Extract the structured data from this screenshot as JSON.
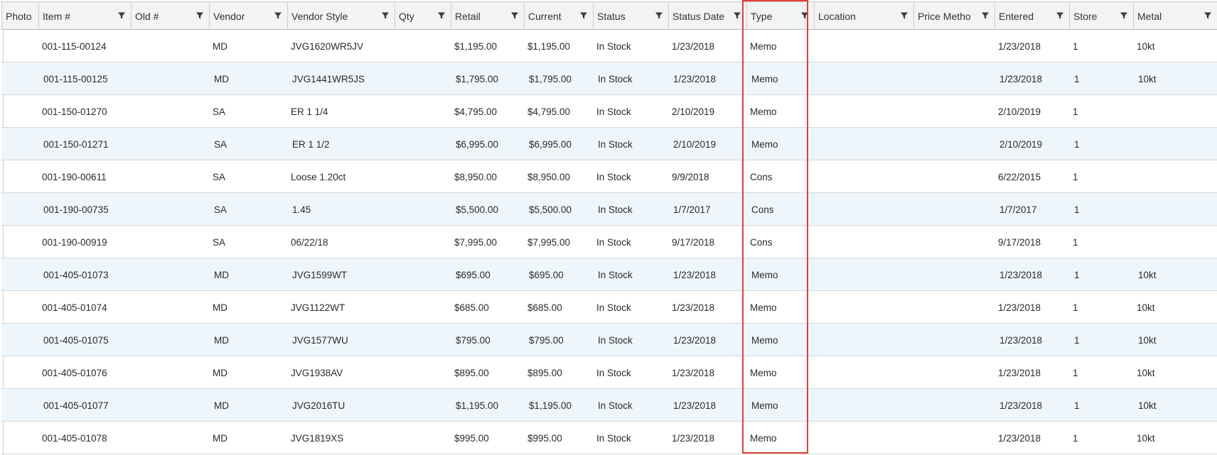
{
  "columns": [
    {
      "key": "photo",
      "label": "Photo",
      "filter": false
    },
    {
      "key": "item",
      "label": "Item #",
      "filter": true
    },
    {
      "key": "old",
      "label": "Old #",
      "filter": true
    },
    {
      "key": "vendor",
      "label": "Vendor",
      "filter": true
    },
    {
      "key": "vendor_style",
      "label": "Vendor Style",
      "filter": true
    },
    {
      "key": "qty",
      "label": "Qty",
      "filter": true
    },
    {
      "key": "retail",
      "label": "Retail",
      "filter": true
    },
    {
      "key": "current",
      "label": "Current",
      "filter": true
    },
    {
      "key": "status",
      "label": "Status",
      "filter": true
    },
    {
      "key": "status_date",
      "label": "Status Date",
      "filter": true
    },
    {
      "key": "type",
      "label": "Type",
      "filter": true
    },
    {
      "key": "location",
      "label": "Location",
      "filter": true
    },
    {
      "key": "price_method",
      "label": "Price Metho",
      "filter": true
    },
    {
      "key": "entered",
      "label": "Entered",
      "filter": true
    },
    {
      "key": "store",
      "label": "Store",
      "filter": true
    },
    {
      "key": "metal",
      "label": "Metal",
      "filter": true
    }
  ],
  "rows": [
    {
      "item": "001-115-00124",
      "old": "",
      "vendor": "MD",
      "vendor_style": "JVG1620WR5JV",
      "qty": "",
      "retail": "$1,195.00",
      "current": "$1,195.00",
      "status": "In Stock",
      "status_date": "1/23/2018",
      "type": "Memo",
      "location": "",
      "price_method": "",
      "entered": "1/23/2018",
      "store": "1",
      "metal": "10kt"
    },
    {
      "item": "001-115-00125",
      "old": "",
      "vendor": "MD",
      "vendor_style": "JVG1441WR5JS",
      "qty": "",
      "retail": "$1,795.00",
      "current": "$1,795.00",
      "status": "In Stock",
      "status_date": "1/23/2018",
      "type": "Memo",
      "location": "",
      "price_method": "",
      "entered": "1/23/2018",
      "store": "1",
      "metal": "10kt"
    },
    {
      "item": "001-150-01270",
      "old": "",
      "vendor": "SA",
      "vendor_style": "ER 1 1/4",
      "qty": "",
      "retail": "$4,795.00",
      "current": "$4,795.00",
      "status": "In Stock",
      "status_date": "2/10/2019",
      "type": "Memo",
      "location": "",
      "price_method": "",
      "entered": "2/10/2019",
      "store": "1",
      "metal": ""
    },
    {
      "item": "001-150-01271",
      "old": "",
      "vendor": "SA",
      "vendor_style": "ER 1 1/2",
      "qty": "",
      "retail": "$6,995.00",
      "current": "$6,995.00",
      "status": "In Stock",
      "status_date": "2/10/2019",
      "type": "Memo",
      "location": "",
      "price_method": "",
      "entered": "2/10/2019",
      "store": "1",
      "metal": ""
    },
    {
      "item": "001-190-00611",
      "old": "",
      "vendor": "SA",
      "vendor_style": "Loose 1.20ct",
      "qty": "",
      "retail": "$8,950.00",
      "current": "$8,950.00",
      "status": "In Stock",
      "status_date": "9/9/2018",
      "type": "Cons",
      "location": "",
      "price_method": "",
      "entered": "6/22/2015",
      "store": "1",
      "metal": ""
    },
    {
      "item": "001-190-00735",
      "old": "",
      "vendor": "SA",
      "vendor_style": "1.45",
      "qty": "",
      "retail": "$5,500.00",
      "current": "$5,500.00",
      "status": "In Stock",
      "status_date": "1/7/2017",
      "type": "Cons",
      "location": "",
      "price_method": "",
      "entered": "1/7/2017",
      "store": "1",
      "metal": ""
    },
    {
      "item": "001-190-00919",
      "old": "",
      "vendor": "SA",
      "vendor_style": "06/22/18",
      "qty": "",
      "retail": "$7,995.00",
      "current": "$7,995.00",
      "status": "In Stock",
      "status_date": "9/17/2018",
      "type": "Cons",
      "location": "",
      "price_method": "",
      "entered": "9/17/2018",
      "store": "1",
      "metal": ""
    },
    {
      "item": "001-405-01073",
      "old": "",
      "vendor": "MD",
      "vendor_style": "JVG1599WT",
      "qty": "",
      "retail": "$695.00",
      "current": "$695.00",
      "status": "In Stock",
      "status_date": "1/23/2018",
      "type": "Memo",
      "location": "",
      "price_method": "",
      "entered": "1/23/2018",
      "store": "1",
      "metal": "10kt"
    },
    {
      "item": "001-405-01074",
      "old": "",
      "vendor": "MD",
      "vendor_style": "JVG1122WT",
      "qty": "",
      "retail": "$685.00",
      "current": "$685.00",
      "status": "In Stock",
      "status_date": "1/23/2018",
      "type": "Memo",
      "location": "",
      "price_method": "",
      "entered": "1/23/2018",
      "store": "1",
      "metal": "10kt"
    },
    {
      "item": "001-405-01075",
      "old": "",
      "vendor": "MD",
      "vendor_style": "JVG1577WU",
      "qty": "",
      "retail": "$795.00",
      "current": "$795.00",
      "status": "In Stock",
      "status_date": "1/23/2018",
      "type": "Memo",
      "location": "",
      "price_method": "",
      "entered": "1/23/2018",
      "store": "1",
      "metal": "10kt"
    },
    {
      "item": "001-405-01076",
      "old": "",
      "vendor": "MD",
      "vendor_style": "JVG1938AV",
      "qty": "",
      "retail": "$895.00",
      "current": "$895.00",
      "status": "In Stock",
      "status_date": "1/23/2018",
      "type": "Memo",
      "location": "",
      "price_method": "",
      "entered": "1/23/2018",
      "store": "1",
      "metal": "10kt"
    },
    {
      "item": "001-405-01077",
      "old": "",
      "vendor": "MD",
      "vendor_style": "JVG2016TU",
      "qty": "",
      "retail": "$1,195.00",
      "current": "$1,195.00",
      "status": "In Stock",
      "status_date": "1/23/2018",
      "type": "Memo",
      "location": "",
      "price_method": "",
      "entered": "1/23/2018",
      "store": "1",
      "metal": "10kt"
    },
    {
      "item": "001-405-01078",
      "old": "",
      "vendor": "MD",
      "vendor_style": "JVG1819XS",
      "qty": "",
      "retail": "$995.00",
      "current": "$995.00",
      "status": "In Stock",
      "status_date": "1/23/2018",
      "type": "Memo",
      "location": "",
      "price_method": "",
      "entered": "1/23/2018",
      "store": "1",
      "metal": "10kt"
    }
  ],
  "colors": {
    "highlight": "#e0403a",
    "alt_row": "#eef6fc",
    "header_bg": "#f3f3f3"
  },
  "icons": {
    "filter": "filter-funnel-icon"
  }
}
